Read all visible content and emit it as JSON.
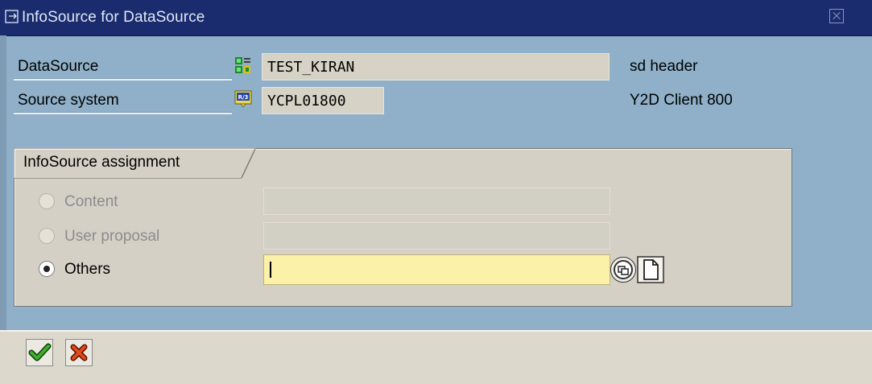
{
  "window": {
    "title": "InfoSource for DataSource",
    "title_icon": "window-edit-icon",
    "close_icon": "close-icon"
  },
  "header_fields": [
    {
      "label": "DataSource",
      "icon": "datasource-icon",
      "value": "TEST_KIRAN",
      "description": "sd header"
    },
    {
      "label": "Source system",
      "icon": "r3-system-icon",
      "value": "YCPL01800",
      "description": "Y2D Client 800"
    }
  ],
  "assignment": {
    "group_title": "InfoSource assignment",
    "options": [
      {
        "label": "Content",
        "selected": false,
        "enabled": false,
        "value": ""
      },
      {
        "label": "User proposal",
        "selected": false,
        "enabled": false,
        "value": ""
      },
      {
        "label": "Others",
        "selected": true,
        "enabled": true,
        "value": ""
      }
    ],
    "field_buttons": [
      "value-help-icon",
      "create-document-icon"
    ]
  },
  "footer": {
    "buttons": [
      {
        "name": "confirm",
        "icon": "checkmark-icon"
      },
      {
        "name": "cancel",
        "icon": "cancel-x-icon"
      }
    ]
  },
  "colors": {
    "titlebar": "#1a2c6e",
    "background": "#8fb0c8",
    "group": "#d5d0c5",
    "active_input": "#fbf1a8"
  }
}
